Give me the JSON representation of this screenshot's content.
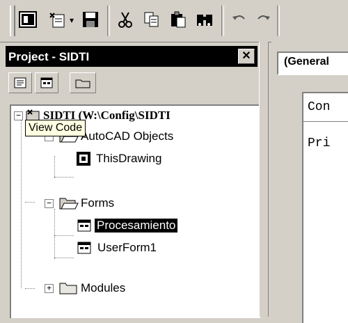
{
  "toolbar": {
    "buttons": [
      {
        "name": "view-autocad-icon"
      },
      {
        "name": "insert-userform-icon"
      },
      {
        "name": "save-icon"
      },
      {
        "name": "cut-icon"
      },
      {
        "name": "copy-icon"
      },
      {
        "name": "paste-icon"
      },
      {
        "name": "find-icon"
      },
      {
        "name": "undo-icon"
      },
      {
        "name": "redo-icon"
      }
    ],
    "dropdown_glyph": "▾"
  },
  "project_panel": {
    "title": "Project - SIDTI",
    "close_glyph": "✕",
    "tooltip": "View Code",
    "tree": {
      "root": {
        "label": "SIDTI (W:\\Config\\SIDTI",
        "expander": "−"
      },
      "groups": [
        {
          "label": "AutoCAD Objects",
          "expander": "−",
          "children": [
            {
              "label": "ThisDrawing"
            }
          ]
        },
        {
          "label": "Forms",
          "expander": "−",
          "children": [
            {
              "label": "Procesamiento",
              "selected": true
            },
            {
              "label": "UserForm1"
            }
          ]
        },
        {
          "label": "Modules",
          "expander": "+",
          "children": []
        }
      ]
    }
  },
  "code_window": {
    "object_combo": "(General",
    "lines": [
      "Con",
      "Pri"
    ]
  }
}
